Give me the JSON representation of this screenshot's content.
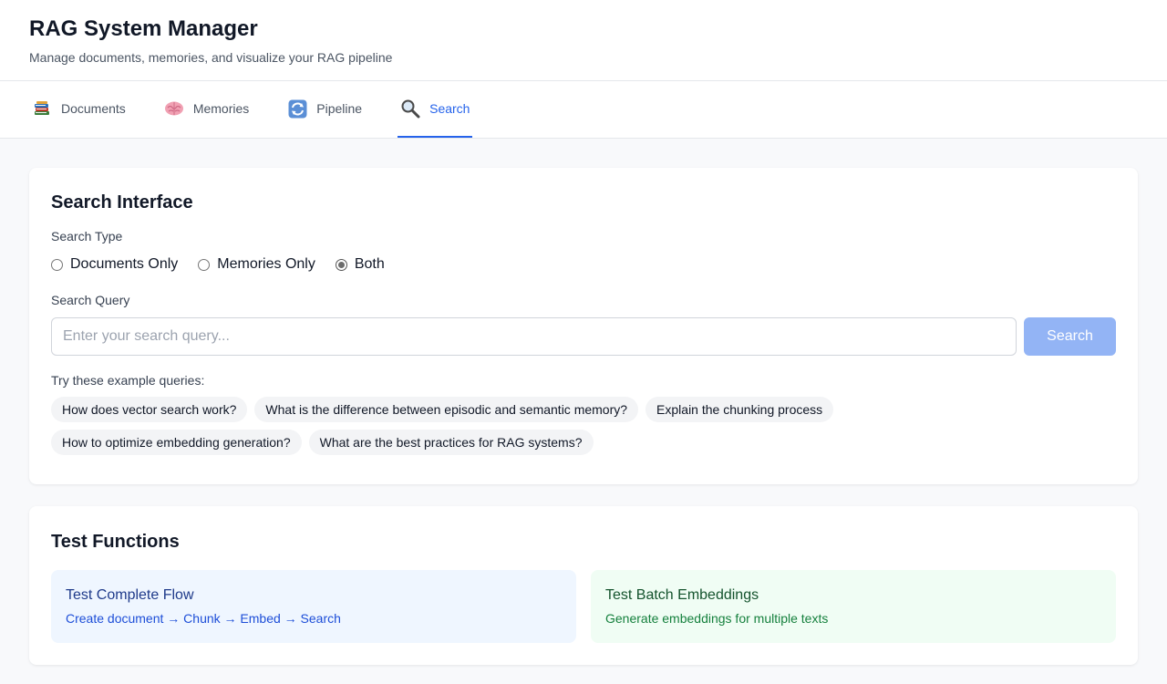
{
  "header": {
    "title": "RAG System Manager",
    "subtitle": "Manage documents, memories, and visualize your RAG pipeline"
  },
  "tabs": [
    {
      "label": "Documents",
      "icon": "books-icon",
      "active": false
    },
    {
      "label": "Memories",
      "icon": "brain-icon",
      "active": false
    },
    {
      "label": "Pipeline",
      "icon": "cycle-icon",
      "active": false
    },
    {
      "label": "Search",
      "icon": "magnifier-icon",
      "active": true
    }
  ],
  "search_card": {
    "title": "Search Interface",
    "type_label": "Search Type",
    "types": [
      {
        "label": "Documents Only",
        "selected": false
      },
      {
        "label": "Memories Only",
        "selected": false
      },
      {
        "label": "Both",
        "selected": true
      }
    ],
    "query_label": "Search Query",
    "query_value": "",
    "query_placeholder": "Enter your search query...",
    "search_button": "Search",
    "examples_label": "Try these example queries:",
    "examples": [
      "How does vector search work?",
      "What is the difference between episodic and semantic memory?",
      "Explain the chunking process",
      "How to optimize embedding generation?",
      "What are the best practices for RAG systems?"
    ]
  },
  "test_card": {
    "title": "Test Functions",
    "tests": [
      {
        "title": "Test Complete Flow",
        "desc": "Create document → Chunk → Embed → Search"
      },
      {
        "title": "Test Batch Embeddings",
        "desc": "Generate embeddings for multiple texts"
      }
    ]
  },
  "colors": {
    "accent": "#2563eb",
    "search_button_disabled": "#93b4f5",
    "test_blue_bg": "#eff6ff",
    "test_green_bg": "#f0fdf4"
  }
}
